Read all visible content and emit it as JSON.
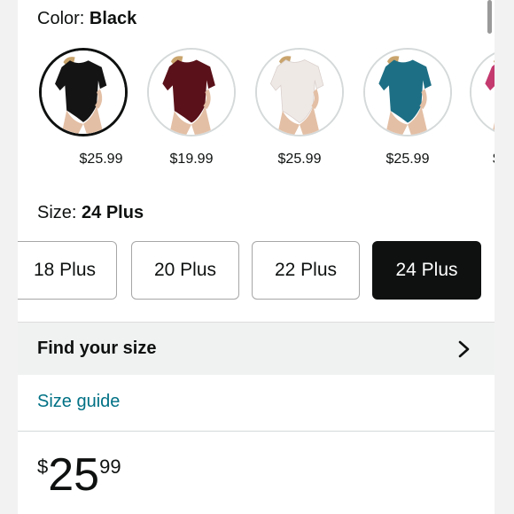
{
  "color": {
    "label": "Color:",
    "value": "Black"
  },
  "swatches": [
    {
      "name": "Black",
      "price": "$25.99",
      "fabric": "#141414",
      "selected": true
    },
    {
      "name": "Burgundy",
      "price": "$19.99",
      "fabric": "#5a1119",
      "selected": false
    },
    {
      "name": "White",
      "price": "$25.99",
      "fabric": "#efe9e6",
      "selected": false
    },
    {
      "name": "Teal",
      "price": "$25.99",
      "fabric": "#1d6f85",
      "selected": false
    },
    {
      "name": "Pink",
      "price": "$",
      "fabric": "#c43a6f",
      "selected": false
    }
  ],
  "size": {
    "label": "Size:",
    "value": "24 Plus"
  },
  "sizes": [
    {
      "label": "18 Plus",
      "selected": false
    },
    {
      "label": "20 Plus",
      "selected": false
    },
    {
      "label": "22 Plus",
      "selected": false
    },
    {
      "label": "24 Plus",
      "selected": true
    }
  ],
  "find_size": {
    "label": "Find your size",
    "icon": "chevron-right-icon"
  },
  "size_guide": {
    "label": "Size guide",
    "color": "#007185"
  },
  "price": {
    "symbol": "$",
    "whole": "25",
    "fraction": "99"
  },
  "colors": {
    "text": "#0f1111",
    "selected": "#0f1111",
    "link": "#007185",
    "section_bg": "#f0f2f2"
  }
}
